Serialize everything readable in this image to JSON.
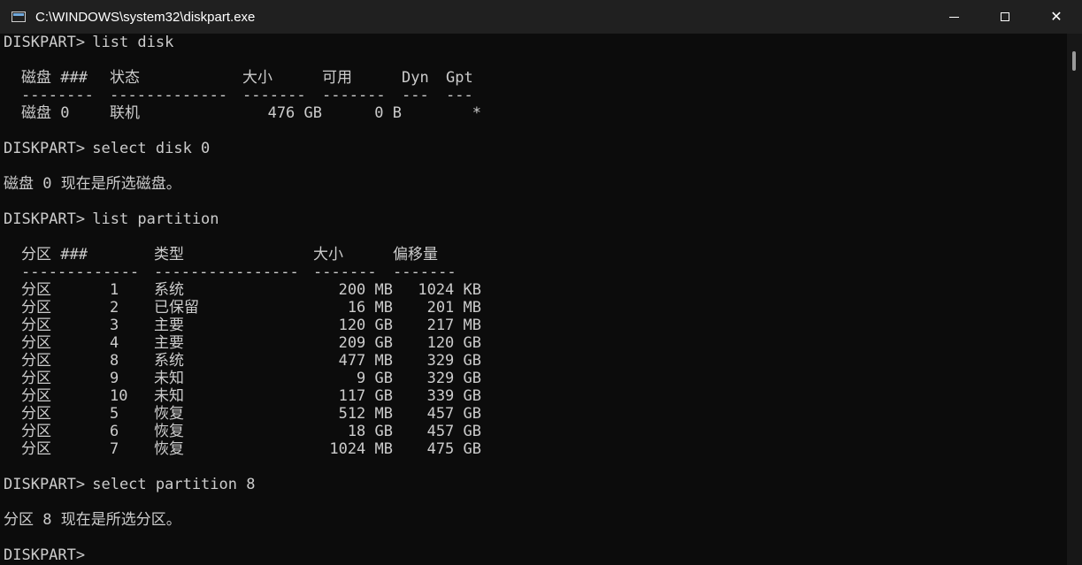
{
  "window": {
    "title": "C:\\WINDOWS\\system32\\diskpart.exe",
    "controls": {
      "minimize": "minimize",
      "maximize": "maximize",
      "close": "✕"
    }
  },
  "console": {
    "prompt": "DISKPART>",
    "cmd_list_disk": " list disk",
    "disk_headers": [
      "磁盘 ###",
      "状态",
      "大小",
      "可用",
      "Dyn",
      "Gpt"
    ],
    "disk_rules": [
      "--------",
      "-------------",
      "-------",
      "-------",
      "---",
      "---"
    ],
    "disk_rows": [
      {
        "disk": "磁盘 0",
        "status": "联机",
        "size": "476 GB",
        "free": "0 B",
        "dyn": "",
        "gpt": "*"
      }
    ],
    "cmd_select_disk": " select disk 0",
    "msg_disk_selected": "磁盘 0 现在是所选磁盘。",
    "cmd_list_partition": " list partition",
    "part_headers": [
      "分区 ###",
      "类型",
      "大小",
      "偏移量"
    ],
    "part_rules": [
      "-------------",
      "----------------",
      "-------",
      "-------"
    ],
    "part_rows": [
      {
        "part": "分区",
        "num": "1",
        "type": "系统",
        "size": "200 MB",
        "offset": "1024 KB"
      },
      {
        "part": "分区",
        "num": "2",
        "type": "已保留",
        "size": "16 MB",
        "offset": "201 MB"
      },
      {
        "part": "分区",
        "num": "3",
        "type": "主要",
        "size": "120 GB",
        "offset": "217 MB"
      },
      {
        "part": "分区",
        "num": "4",
        "type": "主要",
        "size": "209 GB",
        "offset": "120 GB"
      },
      {
        "part": "分区",
        "num": "8",
        "type": "系统",
        "size": "477 MB",
        "offset": "329 GB"
      },
      {
        "part": "分区",
        "num": "9",
        "type": "未知",
        "size": "9 GB",
        "offset": "329 GB"
      },
      {
        "part": "分区",
        "num": "10",
        "type": "未知",
        "size": "117 GB",
        "offset": "339 GB"
      },
      {
        "part": "分区",
        "num": "5",
        "type": "恢复",
        "size": "512 MB",
        "offset": "457 GB"
      },
      {
        "part": "分区",
        "num": "6",
        "type": "恢复",
        "size": "18 GB",
        "offset": "457 GB"
      },
      {
        "part": "分区",
        "num": "7",
        "type": "恢复",
        "size": "1024 MB",
        "offset": "475 GB"
      }
    ],
    "cmd_select_partition": " select partition 8",
    "msg_partition_selected": "分区 8 现在是所选分区。"
  },
  "colors": {
    "background": "#0c0c0c",
    "text": "#cccccc",
    "titlebar": "#202020"
  }
}
